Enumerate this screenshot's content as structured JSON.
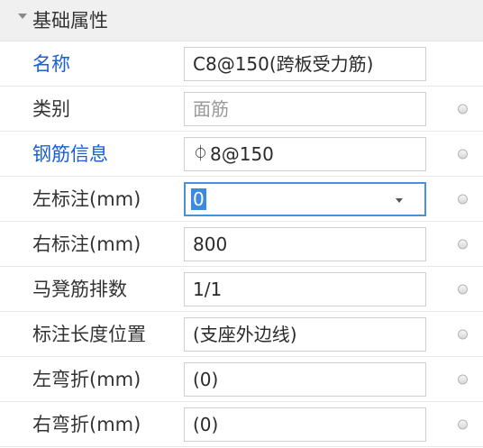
{
  "section": {
    "title": "基础属性"
  },
  "rows": [
    {
      "label": "名称",
      "value": "C8@150(跨板受力筋)"
    },
    {
      "label": "类别",
      "value": "面筋"
    },
    {
      "label": "钢筋信息",
      "glyph": "⏀",
      "value": "8@150"
    },
    {
      "label": "左标注(mm)",
      "value": "0"
    },
    {
      "label": "右标注(mm)",
      "value": "800"
    },
    {
      "label": "马凳筋排数",
      "value": "1/1"
    },
    {
      "label": "标注长度位置",
      "value": "(支座外边线)"
    },
    {
      "label": "左弯折(mm)",
      "value": "(0)"
    },
    {
      "label": "右弯折(mm)",
      "value": "(0)"
    }
  ],
  "colors": {
    "header_bg": "#f0f0f0",
    "blue_label": "#1a5fd6",
    "selection": "#3c8ae0",
    "focus_border": "#4a90d9"
  },
  "icons": {
    "collapse": "triangle-down-icon",
    "dropdown": "chevron-down-icon",
    "radio": "radio-button-icon",
    "rebar": "rebar-grade-symbol-icon"
  }
}
